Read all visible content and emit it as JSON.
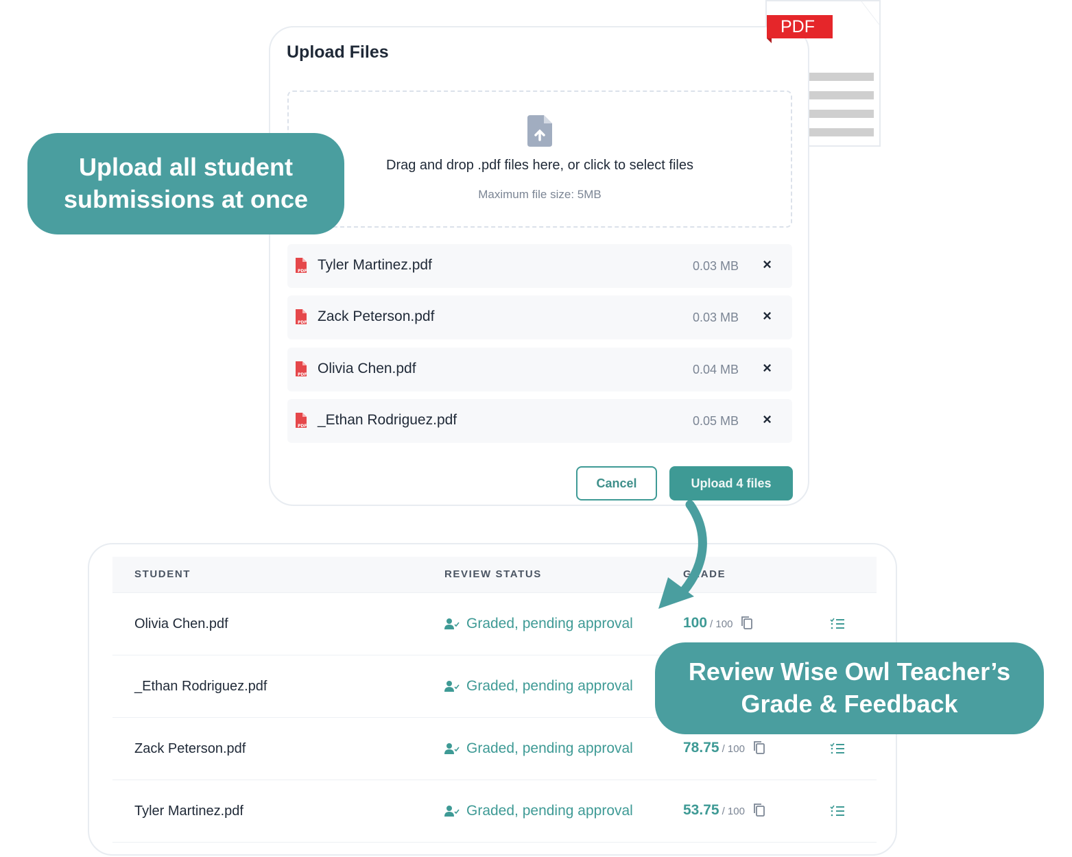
{
  "upload_modal": {
    "title": "Upload Files",
    "dropzone": {
      "icon": "file-upload-icon",
      "text": "Drag and drop .pdf files here, or click to select files",
      "subtext": "Maximum file size: 5MB"
    },
    "files": [
      {
        "name": "Tyler Martinez.pdf",
        "size": "0.03 MB",
        "icon": "pdf-file-icon",
        "remove": "×"
      },
      {
        "name": "Zack Peterson.pdf",
        "size": "0.03 MB",
        "icon": "pdf-file-icon",
        "remove": "×"
      },
      {
        "name": "Olivia Chen.pdf",
        "size": "0.04 MB",
        "icon": "pdf-file-icon",
        "remove": "×"
      },
      {
        "name": "_Ethan Rodriguez.pdf",
        "size": "0.05 MB",
        "icon": "pdf-file-icon",
        "remove": "×"
      }
    ],
    "cancel_label": "Cancel",
    "upload_label": "Upload 4 files"
  },
  "pdf_decoration": {
    "label": "PDF"
  },
  "callouts": {
    "upload": "Upload all student submissions at once",
    "review": "Review Wise Owl Teacher’s Grade & Feedback"
  },
  "grades_table": {
    "headers": {
      "student": "STUDENT",
      "status": "REVIEW STATUS",
      "grade": "GRADE"
    },
    "rows": [
      {
        "student": "Olivia Chen.pdf",
        "status": "Graded, pending approval",
        "grade": "100",
        "max": "/ 100"
      },
      {
        "student": "_Ethan Rodriguez.pdf",
        "status": "Graded, pending approval",
        "grade": "",
        "max": ""
      },
      {
        "student": "Zack Peterson.pdf",
        "status": "Graded, pending approval",
        "grade": "78.75",
        "max": "/ 100"
      },
      {
        "student": "Tyler Martinez.pdf",
        "status": "Graded, pending approval",
        "grade": "53.75",
        "max": "/ 100"
      }
    ]
  },
  "colors": {
    "accent": "#3e9a95",
    "callout": "#4a9e9f",
    "pdf_red": "#e5262a",
    "muted_text": "#7b8594"
  }
}
